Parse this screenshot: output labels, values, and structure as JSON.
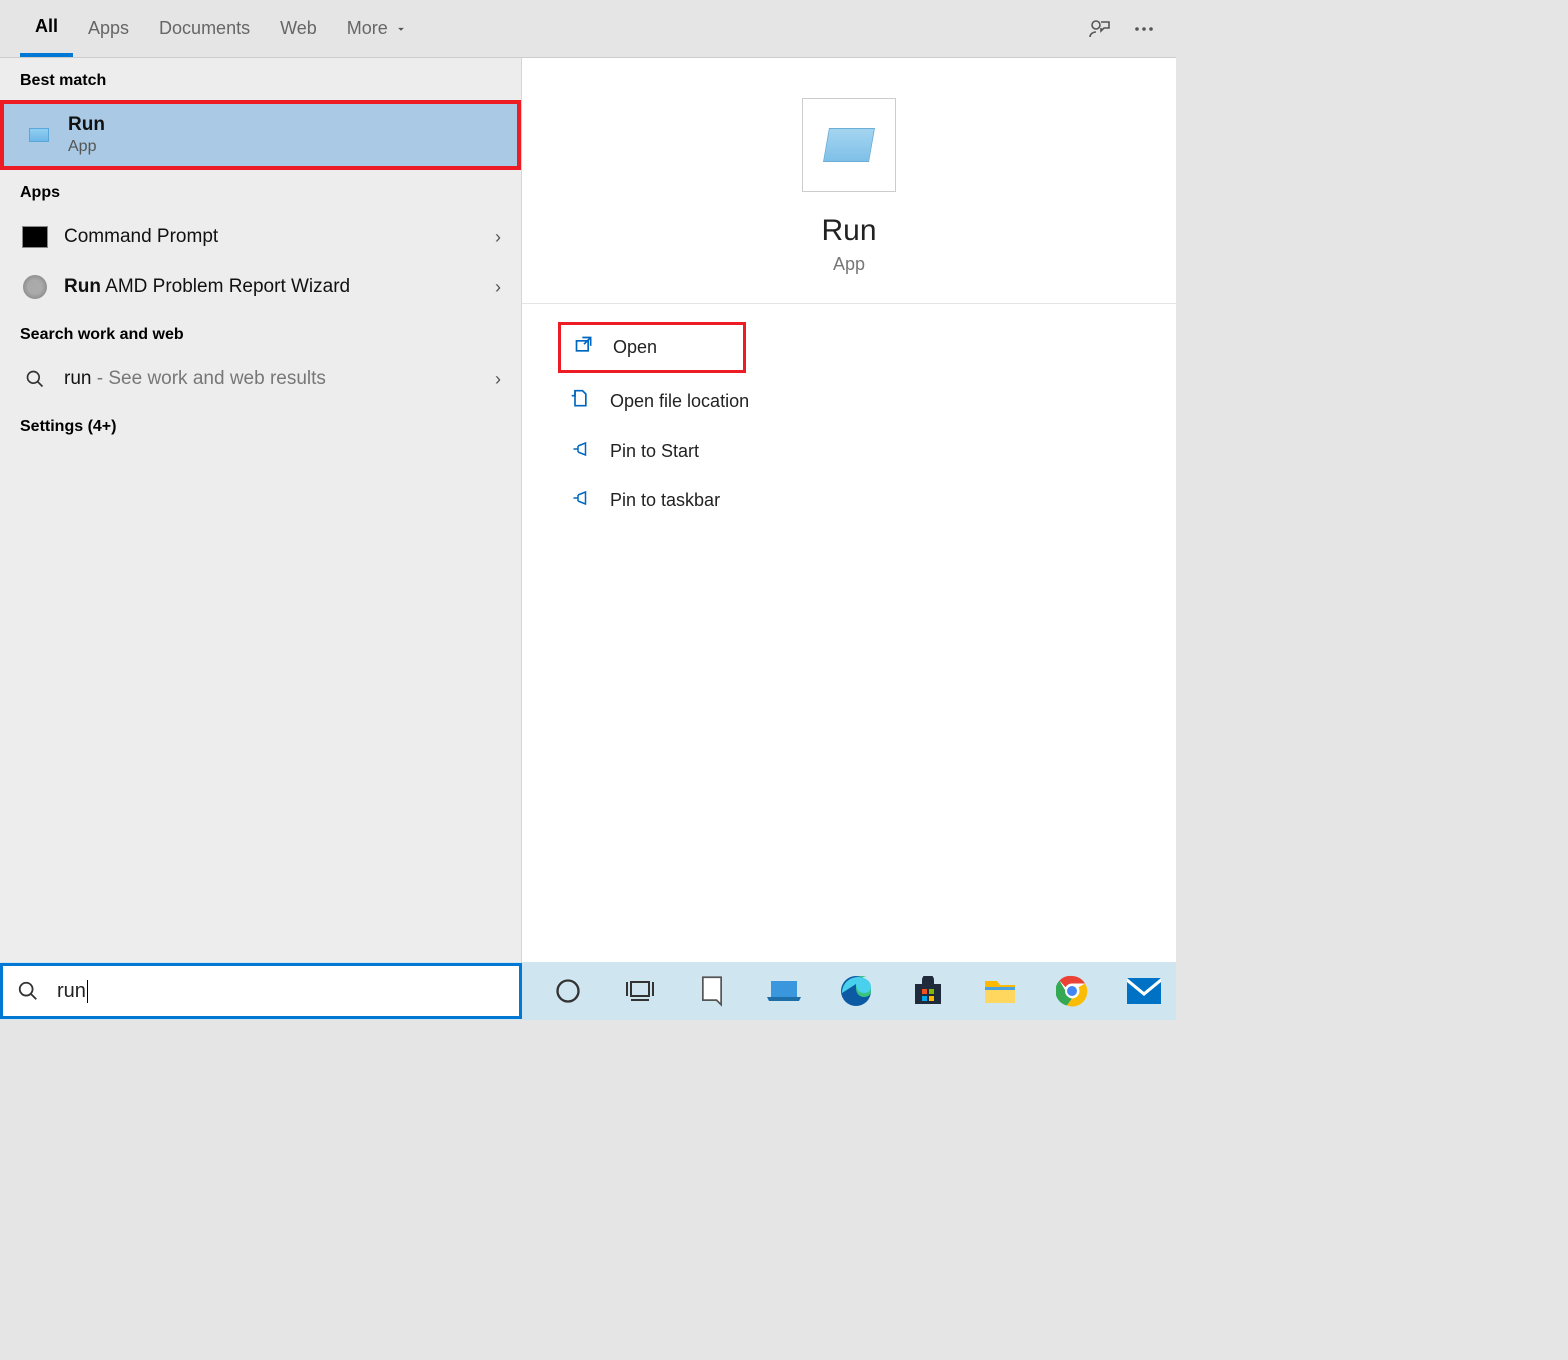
{
  "tabs": {
    "all": "All",
    "apps": "Apps",
    "documents": "Documents",
    "web": "Web",
    "more": "More"
  },
  "sections": {
    "best_match": "Best match",
    "apps": "Apps",
    "search_work_web": "Search work and web",
    "settings_more": "Settings (4+)"
  },
  "best_match": {
    "title": "Run",
    "sub": "App"
  },
  "apps_list": [
    {
      "title": "Command Prompt"
    },
    {
      "title_bold": "Run",
      "title_rest": " AMD Problem Report Wizard"
    }
  ],
  "web_search": {
    "query_bold": "run",
    "hint": " - See work and web results"
  },
  "preview": {
    "title": "Run",
    "sub": "App"
  },
  "actions": {
    "open": "Open",
    "open_file_location": "Open file location",
    "pin_start": "Pin to Start",
    "pin_taskbar": "Pin to taskbar"
  },
  "search_input": "run"
}
